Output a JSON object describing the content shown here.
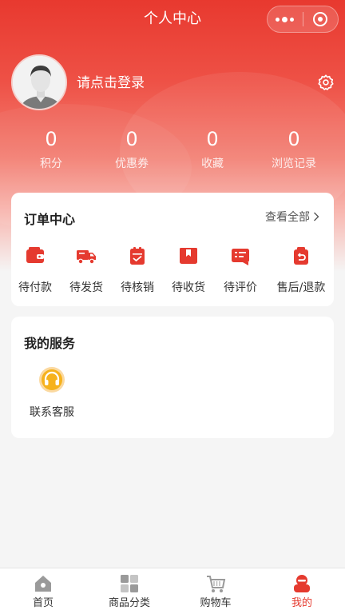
{
  "header": {
    "title": "个人中心"
  },
  "profile": {
    "login_prompt": "请点击登录"
  },
  "stats": [
    {
      "value": "0",
      "label": "积分"
    },
    {
      "value": "0",
      "label": "优惠券"
    },
    {
      "value": "0",
      "label": "收藏"
    },
    {
      "value": "0",
      "label": "浏览记录"
    }
  ],
  "orders": {
    "title": "订单中心",
    "view_all": "查看全部",
    "items": [
      {
        "label": "待付款",
        "icon": "wallet-icon"
      },
      {
        "label": "待发货",
        "icon": "truck-icon"
      },
      {
        "label": "待核销",
        "icon": "clipboard-check-icon"
      },
      {
        "label": "待收货",
        "icon": "box-icon"
      },
      {
        "label": "待评价",
        "icon": "review-icon"
      },
      {
        "label": "售后/退款",
        "icon": "refund-icon"
      }
    ]
  },
  "services": {
    "title": "我的服务",
    "items": [
      {
        "label": "联系客服",
        "icon": "headset-icon"
      }
    ]
  },
  "tabbar": [
    {
      "label": "首页",
      "icon": "home-icon"
    },
    {
      "label": "商品分类",
      "icon": "category-icon"
    },
    {
      "label": "购物车",
      "icon": "cart-icon"
    },
    {
      "label": "我的",
      "icon": "profile-icon",
      "active": true
    }
  ],
  "colors": {
    "accent": "#e53a2f",
    "service_icon": "#f6b21c"
  }
}
